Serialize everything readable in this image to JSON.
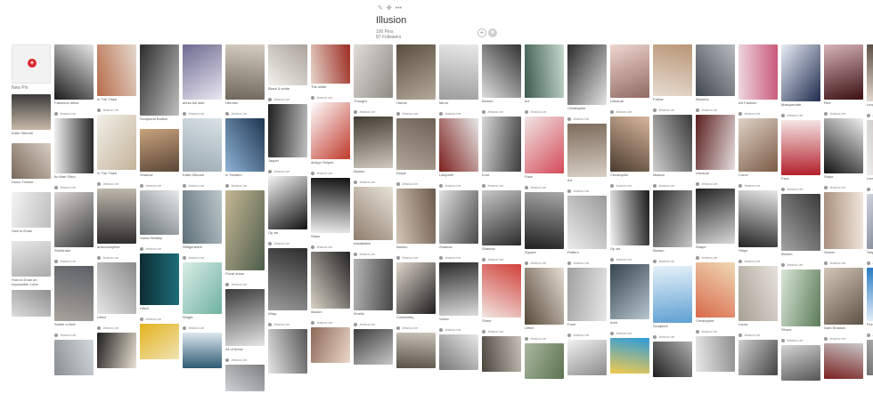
{
  "board": {
    "title": "Illusion",
    "pins_count": "100 Pins",
    "followers": "87 Followers",
    "edit_icons": [
      "pencil-icon",
      "move-icon",
      "more-icon"
    ]
  },
  "new_pin": {
    "label": "New Pin"
  },
  "columns": [
    {
      "items": [
        {
          "h": 40,
          "c": [
            "#c9b8a7",
            "#3b3b3b"
          ],
          "cap": "Katie Gilmore",
          "by": ""
        },
        {
          "h": 40,
          "c": [
            "#7a6a5c",
            "#d7ccc1"
          ],
          "cap": "Victor Thinker",
          "by": ""
        },
        {
          "h": 40,
          "c": [
            "#f4f4f4",
            "#bdbdbd"
          ],
          "cap": "How to Draw",
          "by": ""
        },
        {
          "h": 40,
          "c": [
            "#e8e8e8",
            "#aaaaaa"
          ],
          "cap": "How to Draw an Impossible Cube",
          "by": ""
        },
        {
          "h": 30,
          "c": [
            "#8f8f8f",
            "#dcdcdc"
          ],
          "cap": "",
          "by": ""
        }
      ]
    },
    {
      "items": [
        {
          "h": 62,
          "c": [
            "#1b1b1b",
            "#e7e7e7"
          ],
          "cap": "Fabulous dress",
          "by": "Jessica Lee"
        },
        {
          "h": 62,
          "c": [
            "#efefef",
            "#2a2a2a"
          ],
          "cap": "Ito Mari Shiro",
          "by": "Jessica Lee"
        },
        {
          "h": 62,
          "c": [
            "#d8d6d4",
            "#3a3a3a"
          ],
          "cap": "Sheldrake",
          "by": "Jessica Lee"
        },
        {
          "h": 62,
          "c": [
            "#5b5f66",
            "#a9a49c"
          ],
          "cap": "Subtle a Nice",
          "by": "Jessica Lee"
        },
        {
          "h": 40,
          "c": [
            "#d2d9dd",
            "#8b8f95"
          ],
          "cap": "",
          "by": ""
        }
      ]
    },
    {
      "items": [
        {
          "h": 58,
          "c": [
            "#b86b4a",
            "#e4d8cd"
          ],
          "cap": "In The Thaw",
          "by": "Jessica Lee"
        },
        {
          "h": 62,
          "c": [
            "#f2efe8",
            "#c4b39a"
          ],
          "cap": "In The Thaw",
          "by": "Jessica Lee"
        },
        {
          "h": 62,
          "c": [
            "#bfb7ad",
            "#2e2e2e"
          ],
          "cap": "anticonceptive",
          "by": "Jessica Lee"
        },
        {
          "h": 58,
          "c": [
            "#8a8a8a",
            "#e6e6e6"
          ],
          "cap": "Lifted",
          "by": "Jessica Lee"
        },
        {
          "h": 40,
          "c": [
            "#e9e1d2",
            "#1e1e1e"
          ],
          "cap": "",
          "by": ""
        }
      ]
    },
    {
      "items": [
        {
          "h": 80,
          "c": [
            "#2d2d2d",
            "#bfbfbf"
          ],
          "cap": "Sculptural Bodice",
          "by": ""
        },
        {
          "h": 48,
          "c": [
            "#c8a27d",
            "#5a4636"
          ],
          "cap": "Shadow",
          "by": "Jessica Lee"
        },
        {
          "h": 50,
          "c": [
            "#e7eaec",
            "#6b7479"
          ],
          "cap": "Vivian Whitley",
          "by": "Jessica Lee"
        },
        {
          "h": 58,
          "c": [
            "#1d6d78",
            "#0d2d33"
          ],
          "cap": "Lifted",
          "by": "Jessica Lee"
        },
        {
          "h": 40,
          "c": [
            "#f0e3b4",
            "#e4b21d"
          ],
          "cap": "",
          "by": ""
        }
      ]
    },
    {
      "items": [
        {
          "h": 62,
          "c": [
            "#6d6a8f",
            "#e9e7f2"
          ],
          "cap": "dress full skirt",
          "by": "Jessica Lee"
        },
        {
          "h": 60,
          "c": [
            "#d9e2e7",
            "#9aa8b1"
          ],
          "cap": "Katie Gilmore",
          "by": "Jessica Lee"
        },
        {
          "h": 60,
          "c": [
            "#bcc7cc",
            "#5e6f78"
          ],
          "cap": "Wittgenstein",
          "by": "Jessica Lee"
        },
        {
          "h": 58,
          "c": [
            "#6fb2a0",
            "#d9ede6"
          ],
          "cap": "Wright",
          "by": "Jessica Lee"
        },
        {
          "h": 40,
          "c": [
            "#2e5a73",
            "#dbe7ee"
          ],
          "cap": "",
          "by": ""
        }
      ]
    },
    {
      "items": [
        {
          "h": 62,
          "c": [
            "#d6cdc1",
            "#6f665c"
          ],
          "cap": "Hermes",
          "by": "Jessica Lee"
        },
        {
          "h": 60,
          "c": [
            "#1d3550",
            "#8fb4d6"
          ],
          "cap": "In Tandem",
          "by": "Jessica Lee"
        },
        {
          "h": 90,
          "c": [
            "#4c5d4b",
            "#c6b793"
          ],
          "cap": "Floral dress",
          "by": "Jessica Lee"
        },
        {
          "h": 64,
          "c": [
            "#e5e5e5",
            "#3b3b3b"
          ],
          "cap": "All of these",
          "by": "Jessica Lee"
        },
        {
          "h": 30,
          "c": [
            "#cfd3d4",
            "#7d7f80"
          ],
          "cap": "",
          "by": ""
        }
      ]
    },
    {
      "items": [
        {
          "h": 46,
          "c": [
            "#a9a29a",
            "#f3f0eb"
          ],
          "cap": "Black & white",
          "by": "Jessica Lee"
        },
        {
          "h": 60,
          "c": [
            "#c0c0c0",
            "#1f1f1f"
          ],
          "cap": "Jasper",
          "by": "Jessica Lee"
        },
        {
          "h": 60,
          "c": [
            "#111111",
            "#f4f4f4"
          ],
          "cap": "Op art",
          "by": "Jessica Lee"
        },
        {
          "h": 70,
          "c": [
            "#9b9b9b",
            "#2d2d2d"
          ],
          "cap": "Wrap",
          "by": "Jessica Lee"
        },
        {
          "h": 50,
          "c": [
            "#e6e6e6",
            "#555555"
          ],
          "cap": "",
          "by": ""
        }
      ]
    },
    {
      "items": [
        {
          "h": 44,
          "c": [
            "#9c2b22",
            "#e7d5c9"
          ],
          "cap": "The white",
          "by": "Jessica Lee"
        },
        {
          "h": 64,
          "c": [
            "#c0392b",
            "#ffffff"
          ],
          "cap": "design Stripes",
          "by": "Jessica Lee"
        },
        {
          "h": 62,
          "c": [
            "#f0f0f0",
            "#111111"
          ],
          "cap": "Stripe",
          "by": "Jessica Lee"
        },
        {
          "h": 64,
          "c": [
            "#d9d2c6",
            "#222222"
          ],
          "cap": "Illusion",
          "by": "Jessica Lee"
        },
        {
          "h": 40,
          "c": [
            "#8c6a58",
            "#ecd7c9"
          ],
          "cap": "",
          "by": ""
        }
      ]
    },
    {
      "items": [
        {
          "h": 60,
          "c": [
            "#8e8a84",
            "#e0ddd8"
          ],
          "cap": "Thought",
          "by": "Jessica Lee"
        },
        {
          "h": 58,
          "c": [
            "#cfc9bf",
            "#433c34"
          ],
          "cap": "Illusion",
          "by": "Jessica Lee"
        },
        {
          "h": 60,
          "c": [
            "#8f7e6e",
            "#e9e2d8"
          ],
          "cap": "Installation",
          "by": "Jessica Lee"
        },
        {
          "h": 58,
          "c": [
            "#b5b5b5",
            "#474747"
          ],
          "cap": "Kinetic",
          "by": "Jessica Lee"
        },
        {
          "h": 40,
          "c": [
            "#3e3e3e",
            "#c7c7c7"
          ],
          "cap": "",
          "by": ""
        }
      ]
    },
    {
      "items": [
        {
          "h": 62,
          "c": [
            "#b7a99a",
            "#5a4d40"
          ],
          "cap": "Hands",
          "by": "Jessica Lee"
        },
        {
          "h": 58,
          "c": [
            "#b3a79b",
            "#6c5f53"
          ],
          "cap": "Drape",
          "by": "Jessica Lee"
        },
        {
          "h": 62,
          "c": [
            "#d4c6b8",
            "#6d5a4c"
          ],
          "cap": "Illusion",
          "by": "Jessica Lee"
        },
        {
          "h": 58,
          "c": [
            "#e0d6cc",
            "#1f1f1f"
          ],
          "cap": "Conformity",
          "by": "Jessica Lee"
        },
        {
          "h": 40,
          "c": [
            "#cac3b9",
            "#595149"
          ],
          "cap": "",
          "by": ""
        }
      ]
    },
    {
      "items": [
        {
          "h": 62,
          "c": [
            "#9c9c9c",
            "#e9e9e9"
          ],
          "cap": "Mirror",
          "by": "Jessica Lee"
        },
        {
          "h": 60,
          "c": [
            "#7c1f1b",
            "#e7e7e7"
          ],
          "cap": "Labyrinth",
          "by": "Jessica Lee"
        },
        {
          "h": 60,
          "c": [
            "#e0e0e0",
            "#4a4a4a"
          ],
          "cap": "Shadow",
          "by": "Jessica Lee"
        },
        {
          "h": 60,
          "c": [
            "#2a2a2a",
            "#dcdcdc"
          ],
          "cap": "Vivian",
          "by": "Jessica Lee"
        },
        {
          "h": 40,
          "c": [
            "#e8e8e8",
            "#777777"
          ],
          "cap": "",
          "by": ""
        }
      ]
    },
    {
      "items": [
        {
          "h": 60,
          "c": [
            "#dedede",
            "#333333"
          ],
          "cap": "Illusion",
          "by": "Jessica Lee"
        },
        {
          "h": 62,
          "c": [
            "#d8d8d8",
            "#3c3c3c"
          ],
          "cap": "Knot",
          "by": "Jessica Lee"
        },
        {
          "h": 62,
          "c": [
            "#c8c8c8",
            "#2b2b2b"
          ],
          "cap": "Shadow",
          "by": "Jessica Lee"
        },
        {
          "h": 60,
          "c": [
            "#d2413a",
            "#f1e6e2"
          ],
          "cap": "Sheer",
          "by": "Jessica Lee"
        },
        {
          "h": 40,
          "c": [
            "#c7c0b8",
            "#4a443d"
          ],
          "cap": "",
          "by": ""
        }
      ]
    },
    {
      "items": [
        {
          "h": 60,
          "c": [
            "#3c5a4d",
            "#c6d9ce"
          ],
          "cap": "Art",
          "by": "Jessica Lee"
        },
        {
          "h": 64,
          "c": [
            "#f1e6e4",
            "#d44a58"
          ],
          "cap": "Face",
          "by": "Jessica Lee"
        },
        {
          "h": 64,
          "c": [
            "#a7a7a7",
            "#1f1f1f"
          ],
          "cap": "Square",
          "by": "Jessica Lee"
        },
        {
          "h": 64,
          "c": [
            "#e6ddd2",
            "#56483a"
          ],
          "cap": "Lifted",
          "by": "Jessica Lee"
        },
        {
          "h": 40,
          "c": [
            "#5d7350",
            "#a9b79f"
          ],
          "cap": "",
          "by": ""
        }
      ]
    },
    {
      "items": [
        {
          "h": 68,
          "c": [
            "#2b2b2b",
            "#e4e4e4"
          ],
          "cap": "Christopher",
          "by": "Jessica Lee"
        },
        {
          "h": 60,
          "c": [
            "#7d6b5c",
            "#d8cfc4"
          ],
          "cap": "Art",
          "by": "Jessica Lee"
        },
        {
          "h": 60,
          "c": [
            "#9a9a9a",
            "#ececec"
          ],
          "cap": "Pattern",
          "by": "Jessica Lee"
        },
        {
          "h": 60,
          "c": [
            "#e7e7e7",
            "#a0a0a0"
          ],
          "cap": "Form",
          "by": "Jessica Lee"
        },
        {
          "h": 40,
          "c": [
            "#8a8a8a",
            "#f2f2f2"
          ],
          "cap": "",
          "by": ""
        }
      ]
    },
    {
      "items": [
        {
          "h": 60,
          "c": [
            "#f0d5cf",
            "#8e6a62"
          ],
          "cap": "Unusual",
          "by": "Jessica Lee"
        },
        {
          "h": 62,
          "c": [
            "#d8b79c",
            "#4a3b2e"
          ],
          "cap": "Christopher",
          "by": "Jessica Lee"
        },
        {
          "h": 62,
          "c": [
            "#1a1a1a",
            "#f4f4f4"
          ],
          "cap": "Op art",
          "by": "Jessica Lee"
        },
        {
          "h": 62,
          "c": [
            "#b8c7cf",
            "#35444c"
          ],
          "cap": "Arch",
          "by": "Jessica Lee"
        },
        {
          "h": 40,
          "c": [
            "#f2c94c",
            "#2d9cdb"
          ],
          "cap": "",
          "by": ""
        }
      ]
    },
    {
      "items": [
        {
          "h": 58,
          "c": [
            "#b89574",
            "#e7ddd2"
          ],
          "cap": "Follow",
          "by": "Jessica Lee"
        },
        {
          "h": 64,
          "c": [
            "#3a3a3a",
            "#cfcfcf"
          ],
          "cap": "Maison",
          "by": "Jessica Lee"
        },
        {
          "h": 64,
          "c": [
            "#c6c6c6",
            "#2b2b2b"
          ],
          "cap": "Illusion",
          "by": "Jessica Lee"
        },
        {
          "h": 64,
          "c": [
            "#5fa0d3",
            "#e6f1f8"
          ],
          "cap": "Sculpture",
          "by": "Jessica Lee"
        },
        {
          "h": 40,
          "c": [
            "#1e1e1e",
            "#b0b0b0"
          ],
          "cap": "",
          "by": ""
        }
      ]
    },
    {
      "items": [
        {
          "h": 58,
          "c": [
            "#b8bcc2",
            "#40464e"
          ],
          "cap": "Illusions",
          "by": "Jessica Lee"
        },
        {
          "h": 62,
          "c": [
            "#e7dede",
            "#5a1e1e"
          ],
          "cap": "Unusual",
          "by": "Jessica Lee"
        },
        {
          "h": 62,
          "c": [
            "#d9d9d9",
            "#222222"
          ],
          "cap": "Shape",
          "by": "Jessica Lee"
        },
        {
          "h": 62,
          "c": [
            "#d86a4b",
            "#f0d9b5"
          ],
          "cap": "Christopher",
          "by": "Jessica Lee"
        },
        {
          "h": 40,
          "c": [
            "#e9e9e9",
            "#8f8f8f"
          ],
          "cap": "",
          "by": ""
        }
      ]
    },
    {
      "items": [
        {
          "h": 62,
          "c": [
            "#c9587a",
            "#efd7df"
          ],
          "cap": "Art Fashion",
          "by": "Jessica Lee"
        },
        {
          "h": 60,
          "c": [
            "#7a5b45",
            "#dfd2c6"
          ],
          "cap": "Curve",
          "by": "Jessica Lee"
        },
        {
          "h": 64,
          "c": [
            "#222222",
            "#e8e8e8"
          ],
          "cap": "Stripe",
          "by": "Jessica Lee"
        },
        {
          "h": 62,
          "c": [
            "#a89f95",
            "#e7e2dc"
          ],
          "cap": "Laura",
          "by": "Jessica Lee"
        },
        {
          "h": 40,
          "c": [
            "#cfcfcf",
            "#444444"
          ],
          "cap": "",
          "by": ""
        }
      ]
    },
    {
      "items": [
        {
          "h": 64,
          "c": [
            "#1f2b4d",
            "#e9eef7"
          ],
          "cap": "Masquerade",
          "by": "Jessica Lee"
        },
        {
          "h": 62,
          "c": [
            "#b3202a",
            "#f5e5e5"
          ],
          "cap": "Face",
          "by": "Jessica Lee"
        },
        {
          "h": 64,
          "c": [
            "#a3a3a3",
            "#3a3a3a"
          ],
          "cap": "Illusion",
          "by": "Jessica Lee"
        },
        {
          "h": 64,
          "c": [
            "#d8e6d6",
            "#5b7a58"
          ],
          "cap": "Shoes",
          "by": "Jessica Lee"
        },
        {
          "h": 40,
          "c": [
            "#d5d5d5",
            "#555555"
          ],
          "cap": "",
          "by": ""
        }
      ]
    },
    {
      "items": [
        {
          "h": 62,
          "c": [
            "#3a0f12",
            "#d7b3b6"
          ],
          "cap": "Red",
          "by": "Jessica Lee"
        },
        {
          "h": 62,
          "c": [
            "#111111",
            "#f0f0f0"
          ],
          "cap": "Stripe",
          "by": "Jessica Lee"
        },
        {
          "h": 64,
          "c": [
            "#a8907c",
            "#f1e6dd"
          ],
          "cap": "Vessel",
          "by": "Jessica Lee"
        },
        {
          "h": 64,
          "c": [
            "#d4c7b9",
            "#5e5246"
          ],
          "cap": "Dark Shadow",
          "by": "Jessica Lee"
        },
        {
          "h": 40,
          "c": [
            "#c8c8c8",
            "#7a1f1f"
          ],
          "cap": "",
          "by": ""
        }
      ]
    },
    {
      "items": [
        {
          "h": 64,
          "c": [
            "#e6dcd2",
            "#3d3126"
          ],
          "cap": "Leopard",
          "by": "Jessica Lee"
        },
        {
          "h": 62,
          "c": [
            "#f0efed",
            "#a4a29f"
          ],
          "cap": "Lamp",
          "by": "Jessica Lee"
        },
        {
          "h": 62,
          "c": [
            "#cfd3dc",
            "#5b6476"
          ],
          "cap": "Stripe",
          "by": "Jessica Lee"
        },
        {
          "h": 60,
          "c": [
            "#2a7bc4",
            "#e4eff8"
          ],
          "cap": "Floral",
          "by": "Jessica Lee"
        },
        {
          "h": 40,
          "c": [
            "#e0e0e0",
            "#6f6f6f"
          ],
          "cap": "",
          "by": ""
        }
      ]
    }
  ]
}
